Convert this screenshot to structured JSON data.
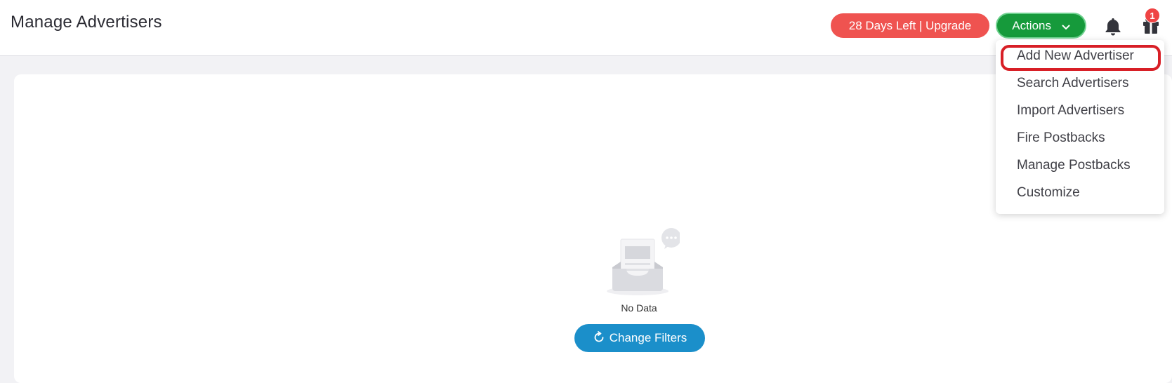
{
  "header": {
    "title": "Manage Advertisers",
    "trial_label": "28 Days Left | Upgrade",
    "actions_label": "Actions",
    "gift_badge_count": "1",
    "icons": {
      "bell": "bell-icon",
      "gift": "gift-icon",
      "chevron": "chevron-down-icon"
    }
  },
  "actions_menu": {
    "items": [
      {
        "label": "Add New Advertiser",
        "highlighted": true
      },
      {
        "label": "Search Advertisers"
      },
      {
        "label": "Import Advertisers"
      },
      {
        "label": "Fire Postbacks"
      },
      {
        "label": "Manage Postbacks"
      },
      {
        "label": "Customize"
      }
    ]
  },
  "main": {
    "empty_text": "No Data",
    "change_filters_label": "Change Filters",
    "icons": {
      "empty": "empty-inbox-icon",
      "refresh": "refresh-icon"
    }
  },
  "colors": {
    "trial_bg": "#ef5350",
    "actions_bg": "#169a3b",
    "change_filters_bg": "#1b8fca",
    "highlight_ring": "#d81f26",
    "badge_bg": "#ef4444"
  }
}
